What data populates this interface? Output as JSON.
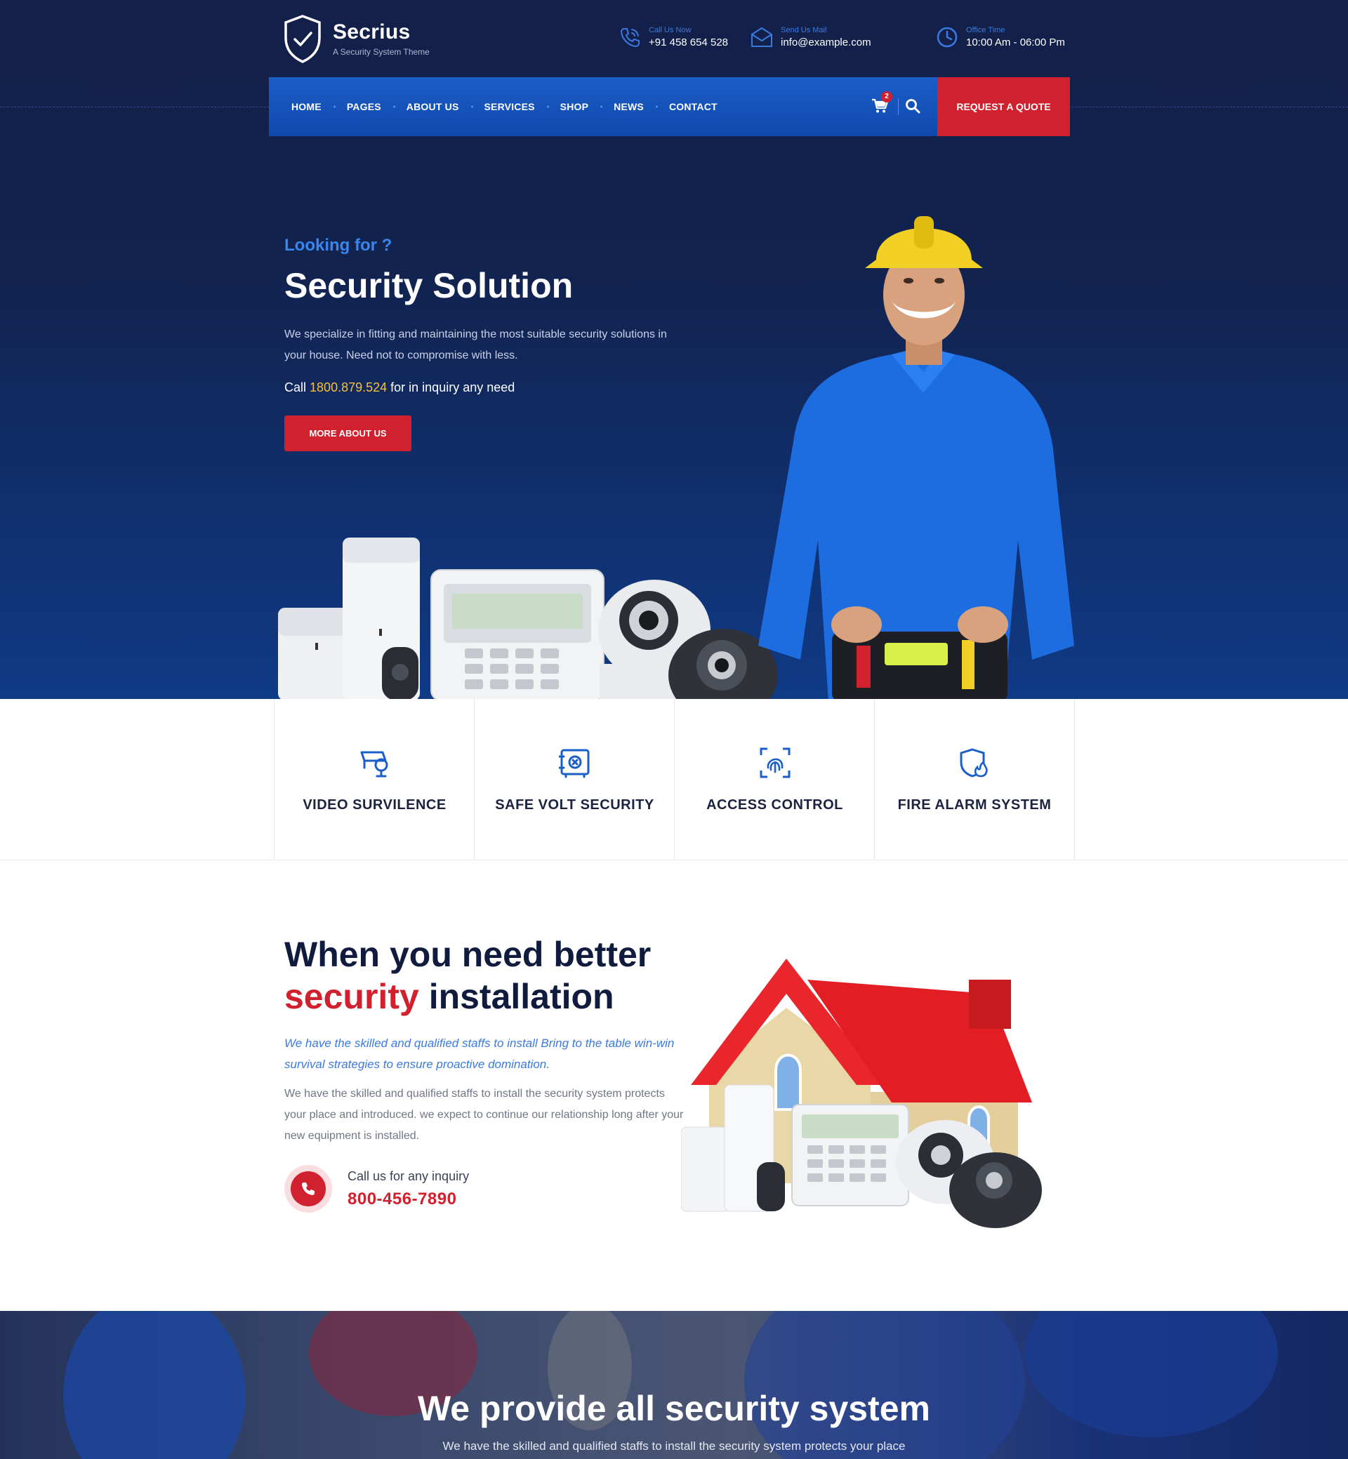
{
  "brand": {
    "name": "Secrius",
    "tagline": "A Security System Theme"
  },
  "contact_bar": {
    "phone": {
      "label": "Call Us Now",
      "value": "+91 458 654 528",
      "icon": "phone-icon"
    },
    "mail": {
      "label": "Send Us Mail",
      "value": "info@example.com",
      "icon": "mail-icon"
    },
    "time": {
      "label": "Office Time",
      "value": "10:00 Am - 06:00 Pm",
      "icon": "clock-icon"
    }
  },
  "nav": {
    "items": [
      "HOME",
      "PAGES",
      "ABOUT US",
      "SERVICES",
      "SHOP",
      "NEWS",
      "CONTACT"
    ],
    "cart_count": "2",
    "quote_button": "REQUEST A QUOTE"
  },
  "hero": {
    "eyebrow": "Looking for ?",
    "title": "Security Solution",
    "description": "We specialize in fitting and maintaining the most suitable security solutions in your house. Need not to compromise with less.",
    "call_prefix": "Call",
    "call_number": "1800.879.524",
    "call_suffix": "for in inquiry any need",
    "button": "MORE ABOUT US"
  },
  "features": [
    {
      "title": "VIDEO SURVILENCE",
      "icon": "cctv-icon"
    },
    {
      "title": "SAFE VOLT SECURITY",
      "icon": "safe-icon"
    },
    {
      "title": "ACCESS CONTROL",
      "icon": "fingerprint-icon"
    },
    {
      "title": "FIRE ALARM SYSTEM",
      "icon": "fire-shield-icon"
    }
  ],
  "about": {
    "heading_line1": "When you need better",
    "heading_highlight": "security",
    "heading_rest": "installation",
    "lead": "We have the skilled and qualified staffs to install Bring to the table win-win survival strategies to ensure proactive domination.",
    "text": "We have the skilled and qualified staffs to install the security system protects your place and introduced. we expect to continue our relationship long after your new equipment is installed.",
    "call_label": "Call us for any inquiry",
    "call_number": "800-456-7890"
  },
  "band": {
    "title": "We provide all security system",
    "subtitle": "We have the skilled and qualified staffs to install the security system protects your place"
  },
  "colors": {
    "navy": "#132049",
    "blue": "#1a5ec7",
    "red": "#d1202e",
    "accent_blue": "#3987ee",
    "yellow": "#f4c23b"
  }
}
